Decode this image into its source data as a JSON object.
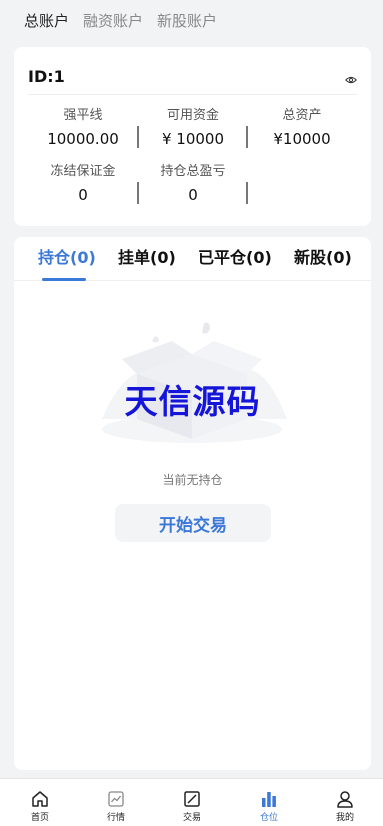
{
  "top_tabs": [
    {
      "label": "总账户"
    },
    {
      "label": "融资账户"
    },
    {
      "label": "新股账户"
    }
  ],
  "account": {
    "id_label": "ID:1",
    "stats": [
      {
        "label": "强平线",
        "value": "10000.00"
      },
      {
        "label": "可用资金",
        "value": "¥ 10000"
      },
      {
        "label": "总资产",
        "value": "¥10000"
      },
      {
        "label": "冻结保证金",
        "value": "0"
      },
      {
        "label": "持仓总盈亏",
        "value": "0"
      }
    ]
  },
  "position_tabs": [
    {
      "label": "持仓(0)"
    },
    {
      "label": "挂单(0)"
    },
    {
      "label": "已平仓(0)"
    },
    {
      "label": "新股(0)"
    }
  ],
  "empty_state": {
    "watermark": "天信源码",
    "message": "当前无持仓",
    "button": "开始交易"
  },
  "bottom_nav": [
    {
      "label": "首页",
      "icon": "home-icon"
    },
    {
      "label": "行情",
      "icon": "market-chart-icon"
    },
    {
      "label": "交易",
      "icon": "trade-icon"
    },
    {
      "label": "仓位",
      "icon": "position-bars-icon"
    },
    {
      "label": "我的",
      "icon": "user-icon"
    }
  ],
  "colors": {
    "accent": "#3b78d8",
    "watermark": "#1515d9",
    "background": "#f2f3f5"
  }
}
